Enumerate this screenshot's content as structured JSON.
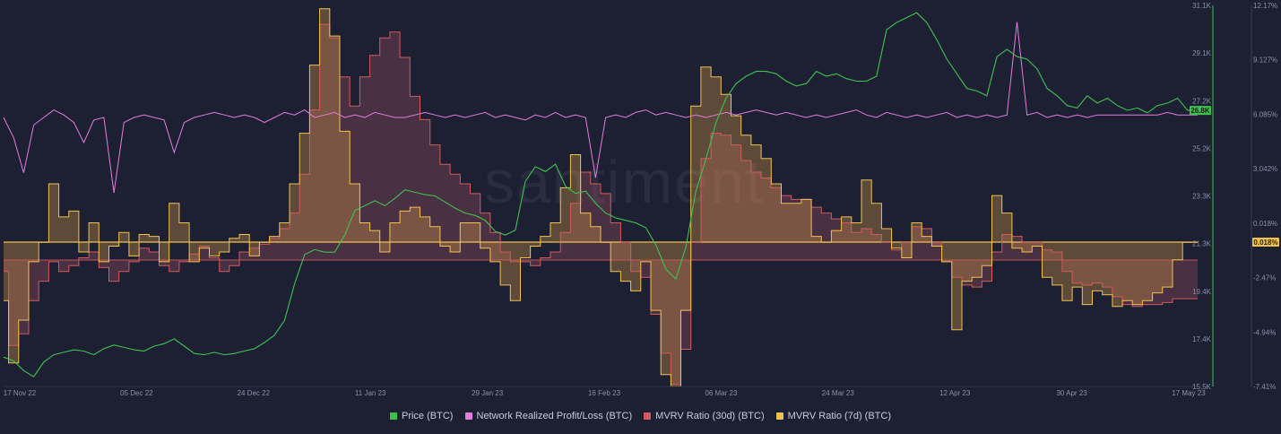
{
  "chart_data": {
    "type": "line",
    "watermark": "santiment",
    "x_ticks": [
      "17 Nov 22",
      "05 Dec 22",
      "24 Dec 22",
      "11 Jan 23",
      "29 Jan 23",
      "16 Feb 23",
      "06 Mar 23",
      "24 Mar 23",
      "12 Apr 23",
      "30 Apr 23",
      "17 May 23"
    ],
    "price_axis": {
      "ticks": [
        "31.1K",
        "29.1K",
        "27.2K",
        "25.2K",
        "23.3K",
        "21.3K",
        "19.4K",
        "17.4K",
        "15.5K"
      ],
      "range": [
        15500,
        31100
      ],
      "current_tag": "26.8K"
    },
    "mvrv_axis": {
      "ticks": [
        "12.17%",
        "9.127%",
        "6.085%",
        "3.042%",
        "0.018%",
        "-2.47%",
        "-4.94%",
        "-7.41%"
      ],
      "range": [
        -7.41,
        12.17
      ],
      "current_tag": "0.018%"
    },
    "series": [
      {
        "name": "Price (BTC)",
        "color": "#3ec24f",
        "axis": "price",
        "values": [
          16700,
          16550,
          16150,
          15900,
          16500,
          16800,
          16900,
          17000,
          16950,
          16800,
          17050,
          17200,
          17100,
          17000,
          16950,
          17150,
          17250,
          17450,
          17150,
          16850,
          16800,
          16900,
          16800,
          16850,
          16950,
          17050,
          17300,
          17600,
          18200,
          19700,
          20900,
          21100,
          21000,
          21000,
          21700,
          22700,
          22900,
          23100,
          22900,
          23200,
          23550,
          23450,
          23350,
          23300,
          23050,
          22800,
          22600,
          22500,
          22300,
          21850,
          21700,
          21900,
          23900,
          24500,
          24300,
          24600,
          23700,
          23400,
          23500,
          23000,
          22600,
          22400,
          22300,
          22200,
          22000,
          21300,
          20300,
          19900,
          21200,
          23500,
          24800,
          26300,
          27300,
          27900,
          28200,
          28400,
          28400,
          28300,
          28000,
          27800,
          27900,
          28400,
          28200,
          28300,
          28100,
          28000,
          28000,
          28200,
          30100,
          30400,
          30600,
          30800,
          30400,
          29700,
          28900,
          28300,
          27700,
          27600,
          27400,
          29000,
          29300,
          29000,
          28900,
          28500,
          27700,
          27400,
          27000,
          26900,
          27400,
          27100,
          27300,
          27000,
          26800,
          26900,
          26700,
          27000,
          27100,
          27300,
          26800,
          26800
        ]
      },
      {
        "name": "Network Realized Profit/Loss (BTC)",
        "color": "#e47bde",
        "axis": "nrpl",
        "values": [
          0,
          -8,
          -22,
          -3,
          0,
          3,
          1,
          -2,
          -10,
          -1,
          0,
          -30,
          -2,
          0,
          1,
          0,
          -1,
          -14,
          -2,
          0,
          1,
          2,
          1,
          0,
          1,
          0,
          -2,
          0,
          2,
          1,
          3,
          0,
          1,
          2,
          0,
          1,
          0,
          2,
          1,
          0,
          0,
          1,
          2,
          1,
          0,
          1,
          0,
          1,
          2,
          0,
          1,
          0,
          -1,
          1,
          0,
          2,
          0,
          1,
          0,
          -24,
          0,
          1,
          0,
          2,
          3,
          1,
          2,
          1,
          0,
          1,
          0,
          1,
          2,
          1,
          2,
          3,
          2,
          1,
          2,
          1,
          0,
          1,
          0,
          1,
          2,
          3,
          1,
          0,
          2,
          1,
          0,
          1,
          0,
          1,
          2,
          0,
          1,
          0,
          1,
          0,
          1,
          38,
          1,
          2,
          0,
          1,
          0,
          1,
          0,
          1,
          1,
          1,
          1,
          1,
          1,
          1,
          2,
          1,
          1,
          1
        ]
      },
      {
        "name": "MVRV Ratio (30d) (BTC)",
        "color": "#d45a5c",
        "axis": "mvrv",
        "values": [
          -1.5,
          -5.3,
          -4.7,
          -3.0,
          -2.0,
          -1.0,
          -1.5,
          -1.2,
          -0.8,
          -0.5,
          -1.3,
          -2.0,
          -1.5,
          -1.0,
          -0.3,
          -0.5,
          -1.2,
          -1.5,
          -1.0,
          -0.6,
          -0.2,
          -0.8,
          -1.5,
          -1.2,
          -0.5,
          -0.3,
          -0.1,
          0.2,
          0.7,
          1.5,
          3.5,
          6.8,
          11.2,
          10.5,
          8.5,
          7.0,
          8.5,
          9.6,
          10.5,
          10.8,
          9.5,
          7.5,
          6.3,
          5.0,
          4.0,
          3.5,
          3.0,
          2.5,
          1.5,
          0.5,
          -0.5,
          -1.0,
          -1.0,
          -1.2,
          -0.8,
          -0.5,
          0.5,
          2.0,
          3.6,
          3.0,
          2.5,
          1.0,
          0.0,
          -1.5,
          -1.8,
          -3.7,
          -5.7,
          -7.3,
          -5.5,
          0.0,
          4.3,
          5.6,
          5.5,
          5.0,
          4.2,
          3.6,
          3.3,
          2.8,
          2.4,
          2.2,
          2.2,
          1.8,
          1.5,
          1.2,
          1.0,
          0.5,
          0.7,
          0.4,
          0.0,
          -0.4,
          0.0,
          0.8,
          0.7,
          0.0,
          -1.0,
          -1.8,
          -2.2,
          -2.3,
          -2.0,
          -0.5,
          0.4,
          0.3,
          0.0,
          0.0,
          -0.4,
          -0.5,
          -1.5,
          -2.1,
          -2.2,
          -2.1,
          -2.3,
          -2.8,
          -3.2,
          -3.3,
          -3.2,
          -3.2,
          -3.1,
          -2.9,
          -2.9,
          -2.9
        ]
      },
      {
        "name": "MVRV Ratio (7d) (BTC)",
        "color": "#f0c24e",
        "axis": "mvrv",
        "values": [
          -3.0,
          -6.2,
          -4.0,
          -1.0,
          0.0,
          3.0,
          1.3,
          1.6,
          -0.5,
          1.0,
          -1.0,
          -0.2,
          0.5,
          -0.7,
          0.4,
          0.3,
          -1.0,
          2.0,
          1.0,
          -1.0,
          -0.3,
          -0.7,
          -0.5,
          0.2,
          0.4,
          -0.7,
          0.0,
          0.3,
          1.0,
          3.0,
          5.6,
          9.1,
          12.0,
          10.6,
          5.7,
          3.0,
          1.0,
          0.6,
          -0.5,
          1.0,
          1.6,
          1.8,
          1.3,
          0.8,
          -0.2,
          -0.5,
          1.0,
          1.0,
          -0.3,
          -1.0,
          -2.2,
          -3.0,
          -0.8,
          -0.2,
          0.3,
          1.0,
          2.8,
          4.5,
          1.5,
          0.8,
          0.0,
          -1.5,
          -2.0,
          -2.5,
          -1.0,
          -3.5,
          -6.8,
          -7.4,
          -3.5,
          7.0,
          9.0,
          8.5,
          7.6,
          6.5,
          5.5,
          5.0,
          4.3,
          3.0,
          2.0,
          2.0,
          2.2,
          0.3,
          0.0,
          0.6,
          1.3,
          1.0,
          3.2,
          2.0,
          0.7,
          -0.3,
          -0.8,
          1.0,
          0.3,
          -0.2,
          -1.0,
          -4.5,
          -2.0,
          -1.8,
          -1.2,
          2.4,
          1.5,
          -0.3,
          -0.5,
          -0.2,
          -1.8,
          -2.2,
          -3.0,
          -2.3,
          -3.2,
          -2.5,
          -2.7,
          -3.3,
          -3.0,
          -3.2,
          -3.0,
          -2.6,
          -2.3,
          -0.9,
          0.0,
          0.0
        ]
      }
    ]
  },
  "legend": {
    "price": "Price (BTC)",
    "nrpl": "Network Realized Profit/Loss (BTC)",
    "mvrv30": "MVRV Ratio (30d) (BTC)",
    "mvrv7": "MVRV Ratio (7d) (BTC)"
  }
}
